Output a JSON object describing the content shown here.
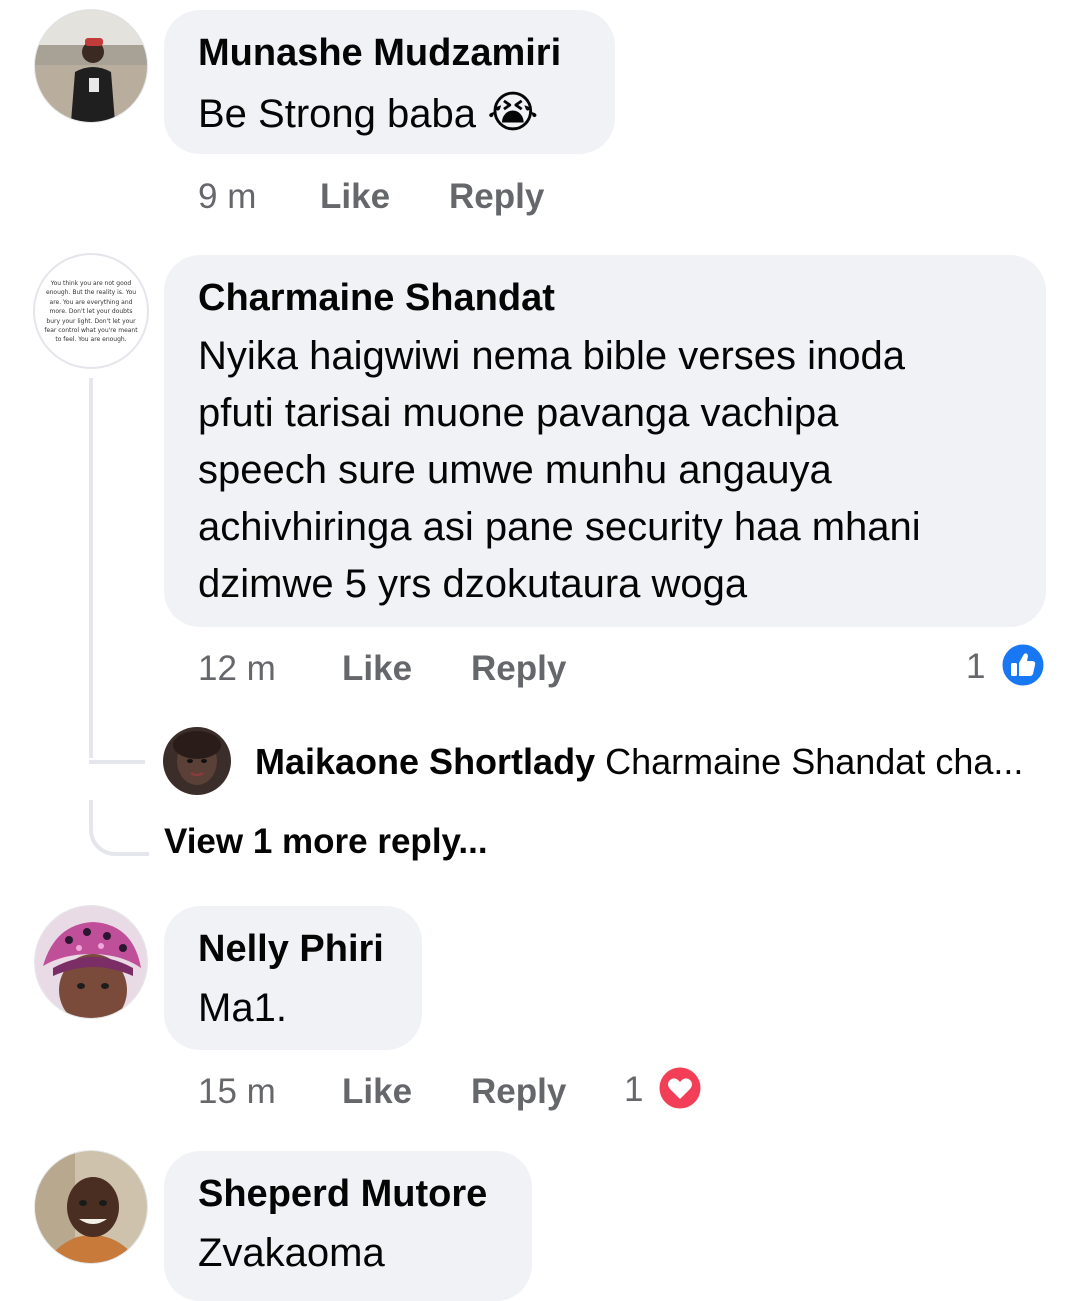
{
  "comments": [
    {
      "author": "Munashe Mudzamiri",
      "text": "Be Strong baba",
      "emoji": "😭",
      "emoji_name": "loudly-crying-face",
      "time": "9 m",
      "like_label": "Like",
      "reply_label": "Reply"
    },
    {
      "author": "Charmaine Shandat",
      "text_lines": [
        "Nyika haigwiwi nema bible verses inoda",
        "pfuti tarisai muone pavanga vachipa",
        "speech sure umwe munhu angauya",
        "achivhiringa asi pane security haa mhani",
        "dzimwe 5 yrs dzokutaura woga"
      ],
      "avatar_text": [
        "You think you are not good",
        "enough. But the reality is. You",
        "are. You are everything and",
        "more. Don't let your doubts",
        "bury your light. Don't let your",
        "fear control what you're meant",
        "to feel. You are enough."
      ],
      "time": "12 m",
      "like_label": "Like",
      "reply_label": "Reply",
      "reaction_count": "1",
      "reaction_icon": "like-thumb-icon",
      "reaction_color": "#1877f2",
      "reply": {
        "author": "Maikaone Shortlady",
        "preview": "Charmaine Shandat cha..."
      },
      "view_more": "View 1 more reply..."
    },
    {
      "author": "Nelly Phiri",
      "text": "Ma1.",
      "time": "15 m",
      "like_label": "Like",
      "reply_label": "Reply",
      "reaction_count": "1",
      "reaction_icon": "love-heart-icon",
      "reaction_color": "#f33e58"
    },
    {
      "author": "Sheperd Mutore",
      "text": "Zvakaoma"
    }
  ],
  "colors": {
    "bubble": "#f0f2f5",
    "meta_text": "#65676b",
    "text": "#050505"
  }
}
